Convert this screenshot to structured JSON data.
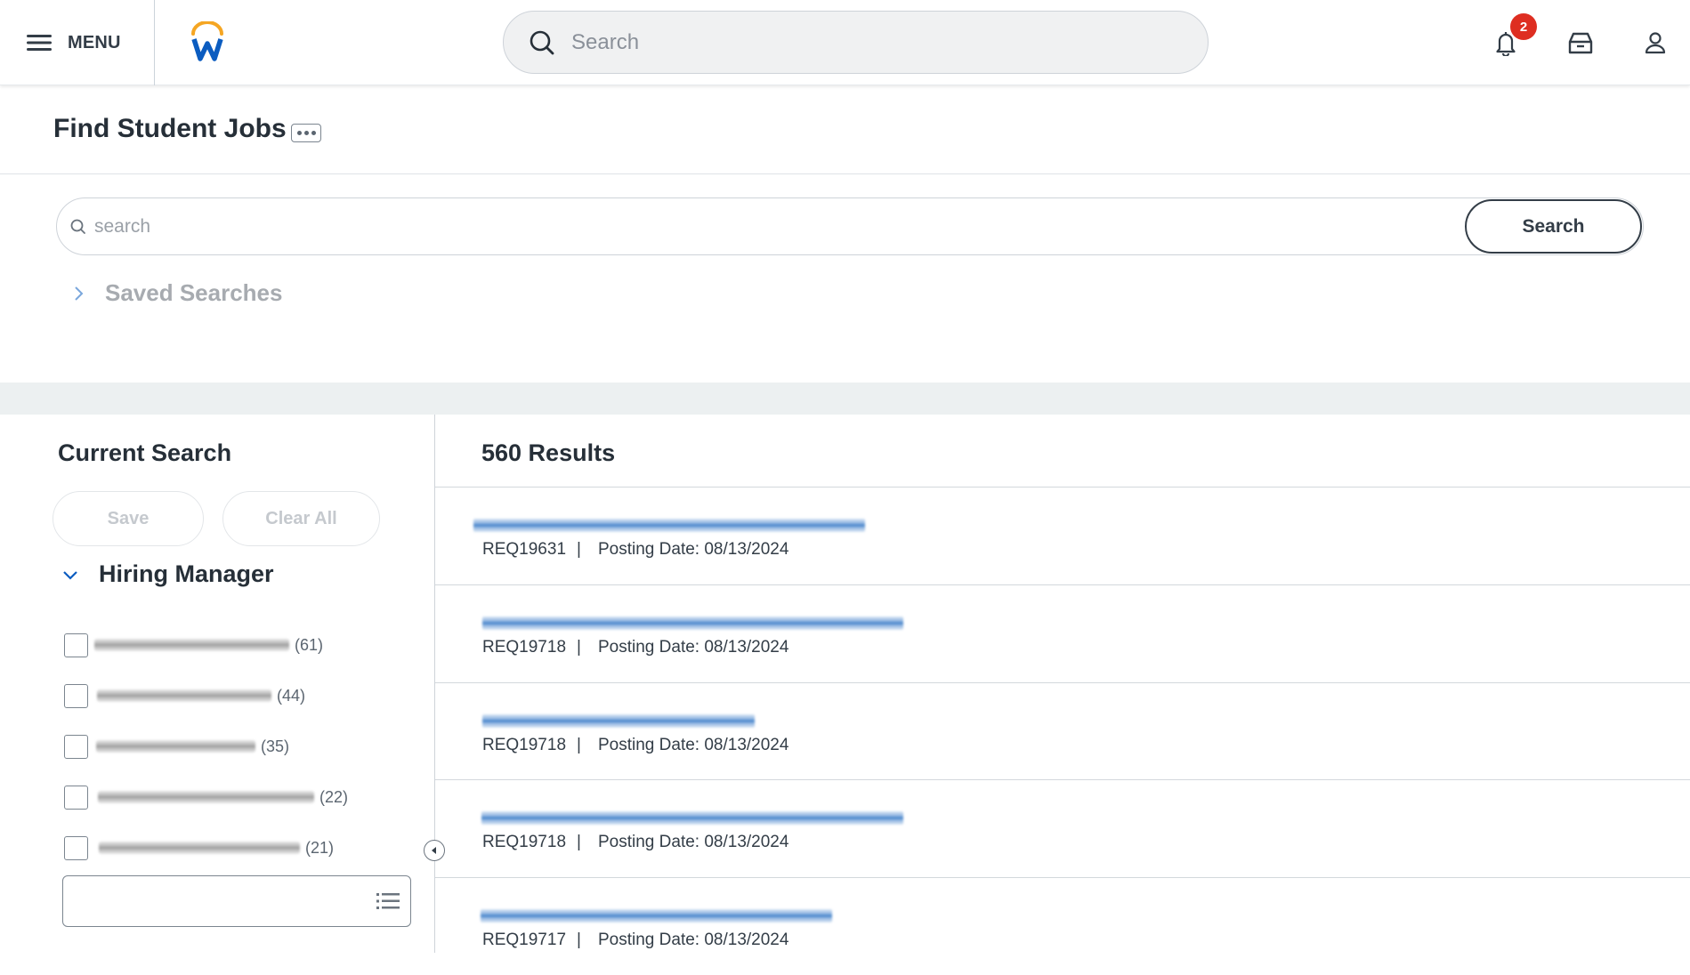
{
  "header": {
    "menu_label": "MENU",
    "logo": "workday-logo",
    "search_placeholder": "Search",
    "notification_count": "2",
    "icons": [
      "menu-icon",
      "search-icon",
      "bell-icon",
      "inbox-icon",
      "user-icon"
    ]
  },
  "page": {
    "title": "Find Student Jobs",
    "more_icon": "ellipsis-icon"
  },
  "search": {
    "placeholder": "search",
    "value": "",
    "button_label": "Search",
    "saved_searches_label": "Saved Searches"
  },
  "left_panel": {
    "heading": "Current Search",
    "save_label": "Save",
    "clear_all_label": "Clear All",
    "facet_heading": "Hiring Manager",
    "facets": [
      {
        "name": "[redacted]",
        "count": "(61)",
        "checked": false
      },
      {
        "name": "[redacted]",
        "count": "(44)",
        "checked": false
      },
      {
        "name": "[redacted]",
        "count": "(35)",
        "checked": false
      },
      {
        "name": "[redacted]",
        "count": "(22)",
        "checked": false
      },
      {
        "name": "[redacted]",
        "count": "(21)",
        "checked": false
      }
    ],
    "facet_prompt_value": ""
  },
  "results": {
    "count_label": "560 Results",
    "items": [
      {
        "title": "[redacted]",
        "req": "REQ19631",
        "separator": "|",
        "posting": "Posting Date: 08/13/2024"
      },
      {
        "title": "[redacted]",
        "req": "REQ19718",
        "separator": "|",
        "posting": "Posting Date: 08/13/2024"
      },
      {
        "title": "[redacted]",
        "req": "REQ19718",
        "separator": "|",
        "posting": "Posting Date: 08/13/2024"
      },
      {
        "title": "[redacted]",
        "req": "REQ19718",
        "separator": "|",
        "posting": "Posting Date: 08/13/2024"
      },
      {
        "title": "[redacted]",
        "req": "REQ19717",
        "separator": "|",
        "posting": "Posting Date: 08/13/2024"
      }
    ]
  },
  "colors": {
    "brand_blue": "#0b5cc0",
    "brand_orange": "#f5a623",
    "badge_red": "#de2e21",
    "text_dark": "#262f38",
    "band_gray": "#ecf0f1"
  }
}
